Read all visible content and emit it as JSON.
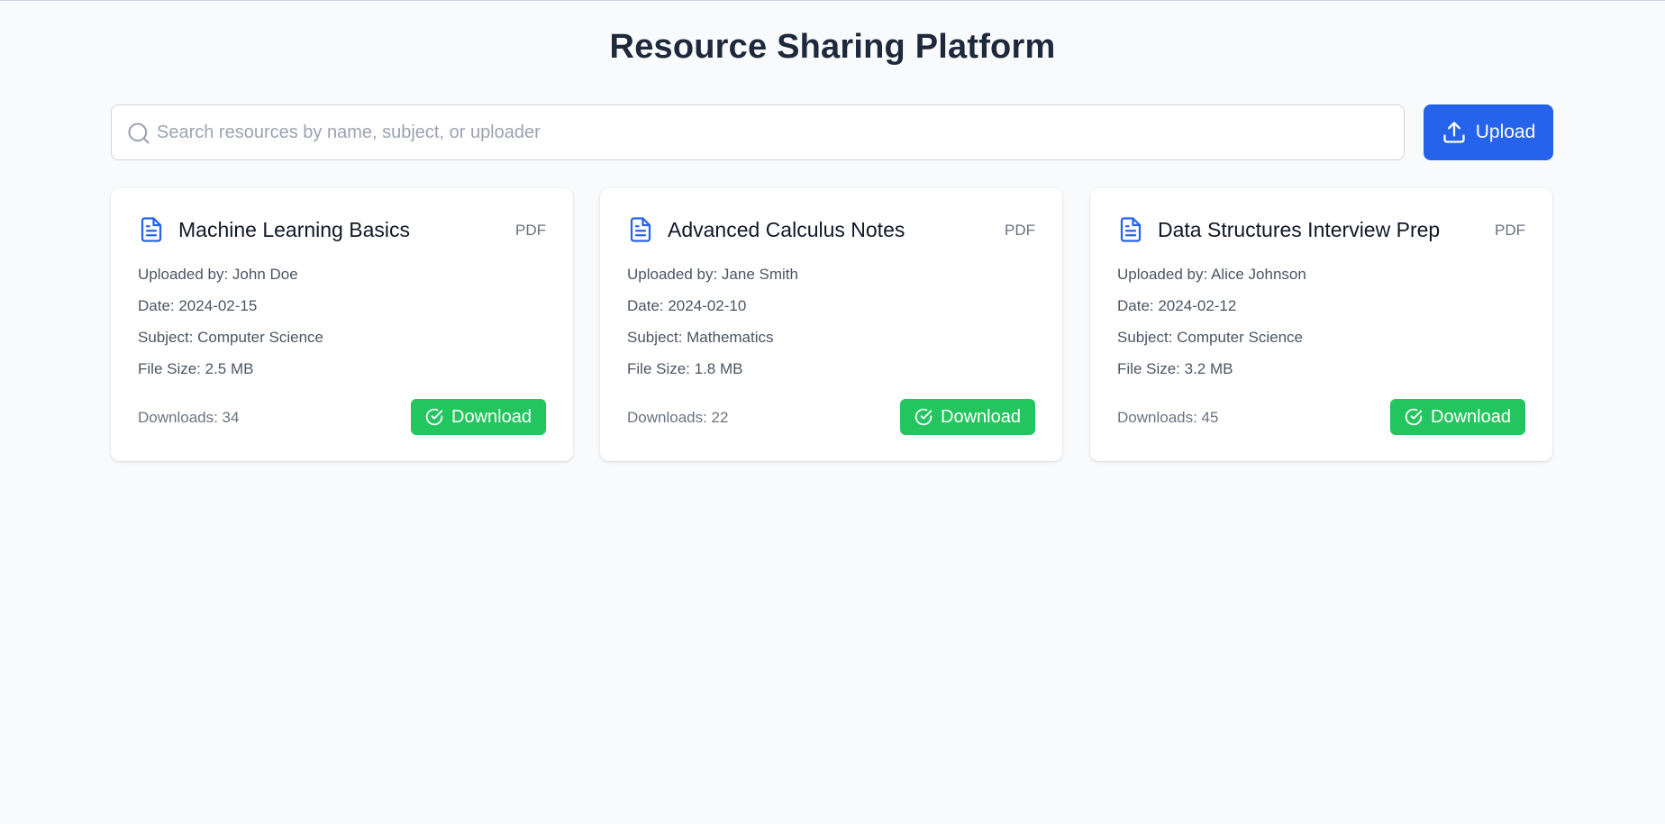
{
  "page": {
    "title": "Resource Sharing Platform"
  },
  "search": {
    "placeholder": "Search resources by name, subject, or uploader",
    "value": "",
    "icon": "search-icon"
  },
  "upload_button": {
    "label": "Upload",
    "icon": "upload-icon"
  },
  "colors": {
    "primary": "#2563eb",
    "success": "#22c55e",
    "background": "#f8fafc"
  },
  "resources": [
    {
      "title": "Machine Learning Basics",
      "type": "PDF",
      "uploaded_by": "Uploaded by: John Doe",
      "date": "Date: 2024-02-15",
      "subject": "Subject: Computer Science",
      "file_size": "File Size: 2.5 MB",
      "downloads": "Downloads: 34",
      "download_label": "Download"
    },
    {
      "title": "Advanced Calculus Notes",
      "type": "PDF",
      "uploaded_by": "Uploaded by: Jane Smith",
      "date": "Date: 2024-02-10",
      "subject": "Subject: Mathematics",
      "file_size": "File Size: 1.8 MB",
      "downloads": "Downloads: 22",
      "download_label": "Download"
    },
    {
      "title": "Data Structures Interview Prep",
      "type": "PDF",
      "uploaded_by": "Uploaded by: Alice Johnson",
      "date": "Date: 2024-02-12",
      "subject": "Subject: Computer Science",
      "file_size": "File Size: 3.2 MB",
      "downloads": "Downloads: 45",
      "download_label": "Download"
    }
  ]
}
